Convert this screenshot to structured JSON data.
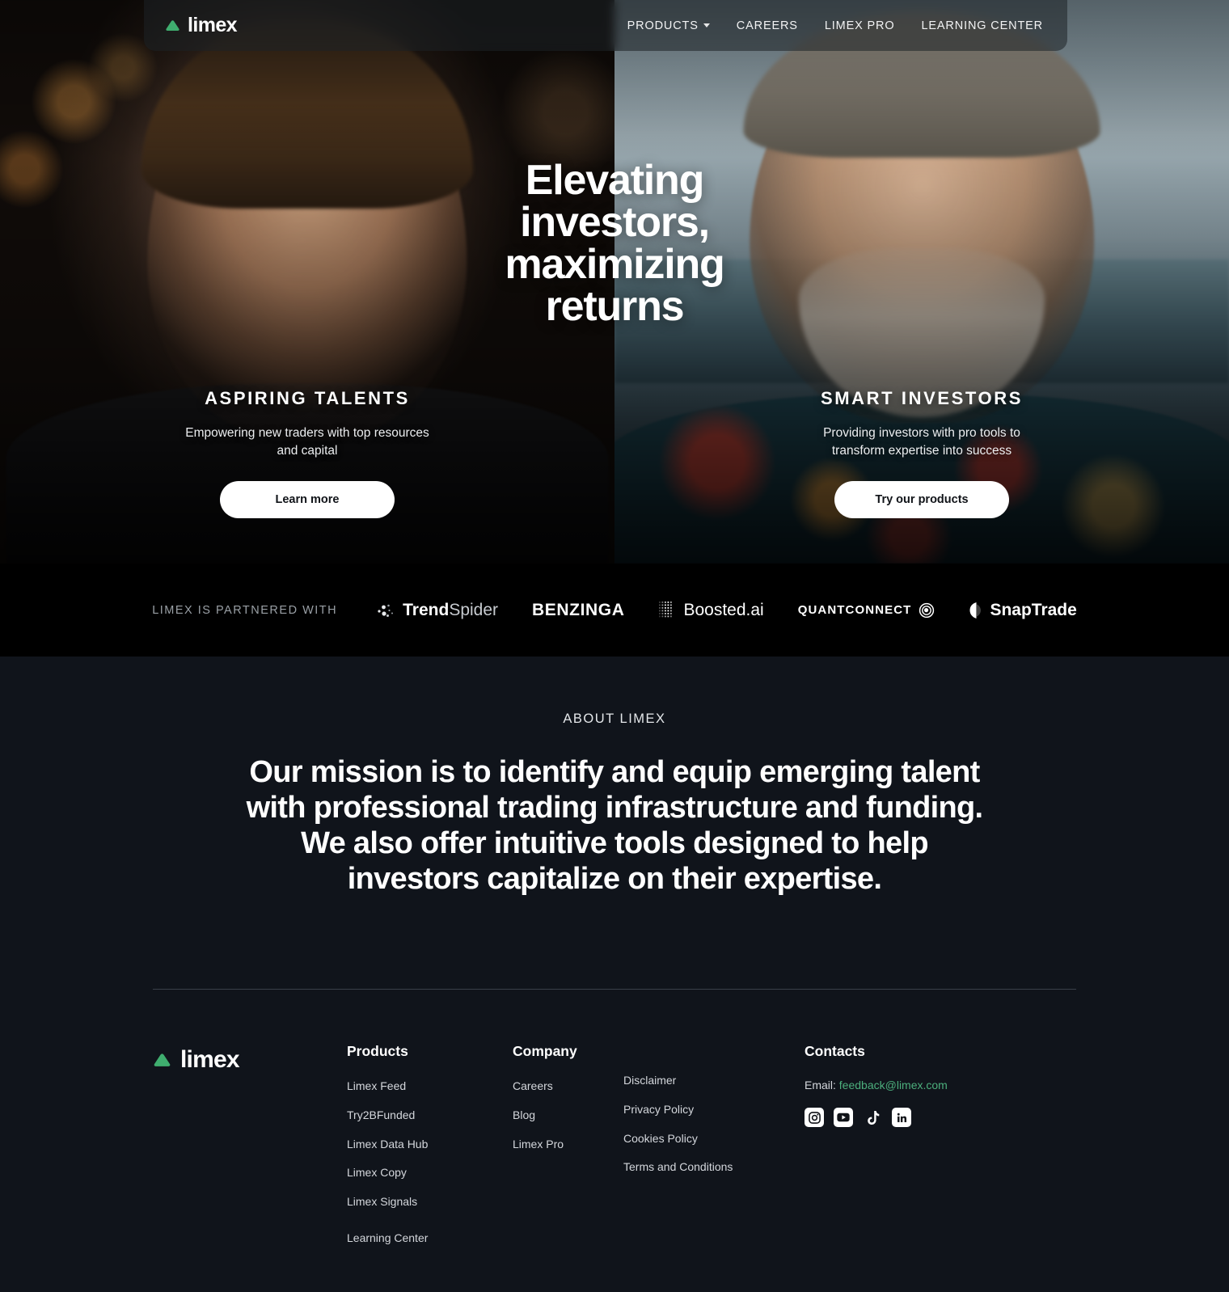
{
  "brand": {
    "name": "limex",
    "mark": "green-triangle-logo-icon"
  },
  "nav": {
    "items": [
      {
        "label": "PRODUCTS",
        "has_dropdown": true
      },
      {
        "label": "CAREERS",
        "has_dropdown": false
      },
      {
        "label": "LIMEX PRO",
        "has_dropdown": false
      },
      {
        "label": "LEARNING CENTER",
        "has_dropdown": false
      }
    ]
  },
  "hero": {
    "headline_lines": [
      "Elevating",
      "investors,",
      "maximizing",
      "returns"
    ],
    "panels": [
      {
        "title": "ASPIRING TALENTS",
        "subtitle": "Empowering new traders with top resources and capital",
        "button": "Learn more"
      },
      {
        "title": "SMART INVESTORS",
        "subtitle": "Providing investors with pro tools to transform expertise into success",
        "button": "Try our products"
      }
    ]
  },
  "partners": {
    "label": "LIMEX IS PARTNERED WITH",
    "logos": [
      {
        "name": "TrendSpider",
        "bold_part": "Trend",
        "light_part": "Spider"
      },
      {
        "name": "BENZINGA"
      },
      {
        "name": "Boosted.ai"
      },
      {
        "name": "QUANTCONNECT"
      },
      {
        "name": "SnapTrade"
      }
    ]
  },
  "about": {
    "eyebrow": "ABOUT LIMEX",
    "text": "Our mission is to identify and equip emerging talent with professional trading infrastructure and funding. We also offer intuitive tools designed to help investors capitalize on their expertise."
  },
  "footer": {
    "products": {
      "heading": "Products",
      "links": [
        "Limex Feed",
        "Try2BFunded",
        "Limex Data Hub",
        "Limex Copy",
        "Limex Signals"
      ],
      "extra_link": "Learning Center"
    },
    "company": {
      "heading": "Company",
      "links": [
        "Careers",
        "Blog",
        "Limex Pro"
      ]
    },
    "legal": {
      "links": [
        "Disclaimer",
        "Privacy Policy",
        "Cookies Policy",
        "Terms and Conditions"
      ]
    },
    "contacts": {
      "heading": "Contacts",
      "email_label": "Email:",
      "email": "feedback@limex.com",
      "socials": [
        {
          "name": "instagram-icon"
        },
        {
          "name": "youtube-icon"
        },
        {
          "name": "tiktok-icon"
        },
        {
          "name": "linkedin-icon"
        }
      ]
    }
  },
  "colors": {
    "accent_green": "#3fae6f",
    "link_green": "#4caf7d",
    "page_bg": "#10141b",
    "partners_bg": "#000000"
  }
}
